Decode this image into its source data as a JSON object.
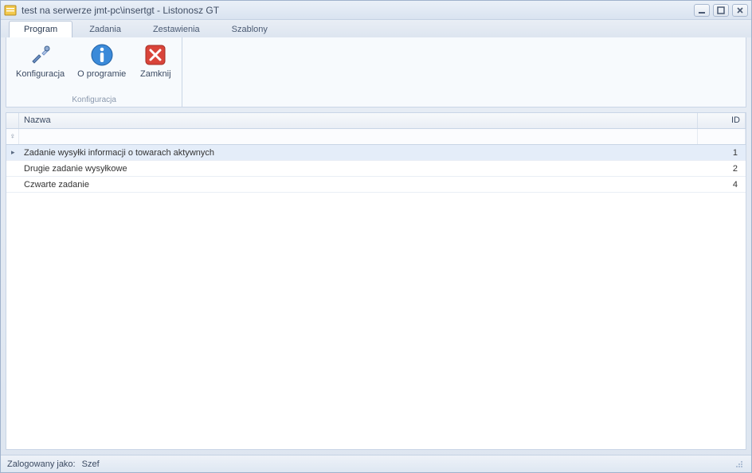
{
  "window": {
    "title": "test na serwerze jmt-pc\\insertgt - Listonosz GT"
  },
  "tabs": [
    {
      "label": "Program",
      "active": true
    },
    {
      "label": "Zadania",
      "active": false
    },
    {
      "label": "Zestawienia",
      "active": false
    },
    {
      "label": "Szablony",
      "active": false
    }
  ],
  "ribbon": {
    "group_label": "Konfiguracja",
    "buttons": {
      "config": {
        "label": "Konfiguracja",
        "icon": "wrench-screwdriver-icon"
      },
      "about": {
        "label": "O programie",
        "icon": "info-icon"
      },
      "close": {
        "label": "Zamknij",
        "icon": "close-x-icon"
      }
    }
  },
  "grid": {
    "columns": {
      "name": "Nazwa",
      "id": "ID"
    },
    "rows": [
      {
        "name": "Zadanie wysyłki informacji o towarach aktywnych",
        "id": "1",
        "selected": true
      },
      {
        "name": "Drugie zadanie wysyłkowe",
        "id": "2",
        "selected": false
      },
      {
        "name": "Czwarte zadanie",
        "id": "4",
        "selected": false
      }
    ]
  },
  "status": {
    "label": "Zalogowany jako:",
    "user": "Szef"
  }
}
